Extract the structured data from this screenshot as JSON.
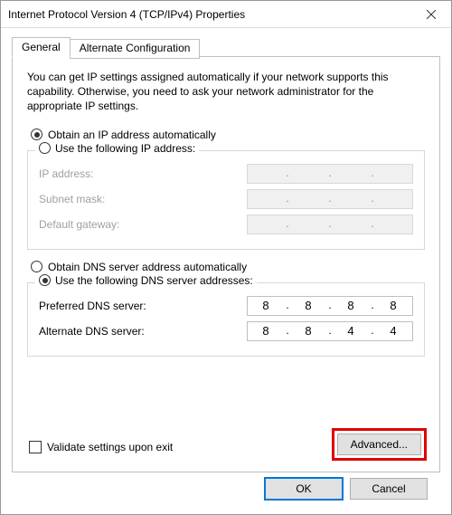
{
  "window": {
    "title": "Internet Protocol Version 4 (TCP/IPv4) Properties"
  },
  "tabs": {
    "general": "General",
    "alternate": "Alternate Configuration"
  },
  "description": "You can get IP settings assigned automatically if your network supports this capability. Otherwise, you need to ask your network administrator for the appropriate IP settings.",
  "ip_section": {
    "auto_label": "Obtain an IP address automatically",
    "manual_label": "Use the following IP address:",
    "ip_label": "IP address:",
    "subnet_label": "Subnet mask:",
    "gateway_label": "Default gateway:"
  },
  "dns_section": {
    "auto_label": "Obtain DNS server address automatically",
    "manual_label": "Use the following DNS server addresses:",
    "preferred_label": "Preferred DNS server:",
    "alternate_label": "Alternate DNS server:",
    "preferred": {
      "o1": "8",
      "o2": "8",
      "o3": "8",
      "o4": "8"
    },
    "alternate": {
      "o1": "8",
      "o2": "8",
      "o3": "4",
      "o4": "4"
    }
  },
  "validate_label": "Validate settings upon exit",
  "advanced_label": "Advanced...",
  "buttons": {
    "ok": "OK",
    "cancel": "Cancel"
  }
}
